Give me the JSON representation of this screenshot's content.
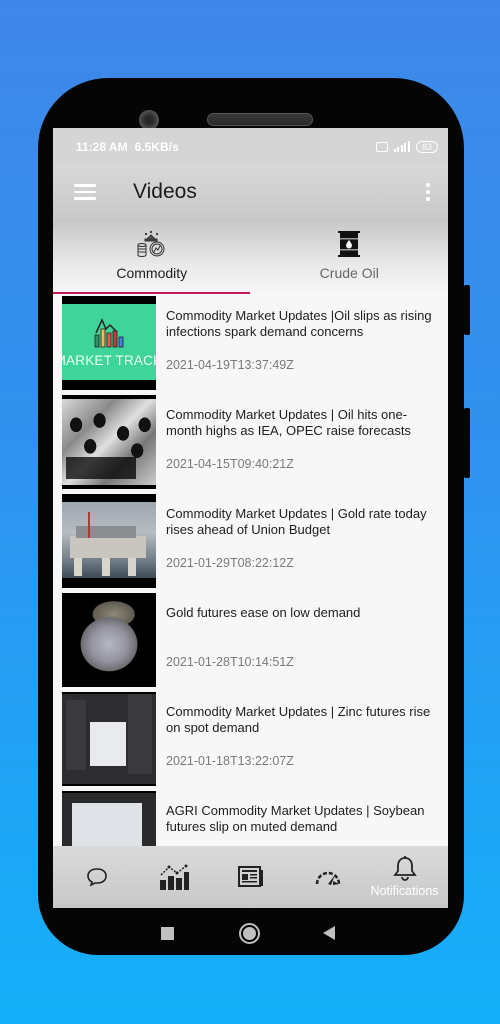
{
  "status_bar": {
    "time": "11:28 AM",
    "network_speed": "6.5KB/s",
    "network_type": "4G",
    "battery": "83"
  },
  "app_bar": {
    "title": "Videos",
    "menu_icon": "hamburger-icon",
    "overflow_icon": "kebab-icon"
  },
  "tabs": [
    {
      "label": "Commodity",
      "icon": "commodity-icon",
      "selected": true
    },
    {
      "label": "Crude Oil",
      "icon": "oil-barrel-icon",
      "selected": false
    }
  ],
  "accent_color": "#c2185b",
  "videos": [
    {
      "title": "Commodity Market Updates |Oil slips as rising infections spark demand concerns",
      "date": "2021-04-19T13:37:49Z",
      "thumb_caption": "MARKET TRACKER"
    },
    {
      "title": "Commodity Market Updates | Oil hits one-month highs as IEA, OPEC raise forecasts",
      "date": "2021-04-15T09:40:21Z"
    },
    {
      "title": "Commodity Market Updates | Gold rate today rises ahead of Union Budget",
      "date": "2021-01-29T08:22:12Z"
    },
    {
      "title": "Gold futures ease on low demand",
      "date": "2021-01-28T10:14:51Z"
    },
    {
      "title": "Commodity Market Updates | Zinc futures rise on spot demand",
      "date": "2021-01-18T13:22:07Z"
    },
    {
      "title": "AGRI Commodity Market Updates | Soybean futures slip on muted demand",
      "date": ""
    }
  ],
  "bottom_nav": [
    {
      "icon": "chat-bubble-icon",
      "label": ""
    },
    {
      "icon": "bar-chart-icon",
      "label": ""
    },
    {
      "icon": "newspaper-icon",
      "label": ""
    },
    {
      "icon": "speedometer-icon",
      "label": ""
    },
    {
      "icon": "bell-icon",
      "label": "Notifications"
    }
  ],
  "system_nav": [
    "recents-button",
    "home-button",
    "back-button"
  ]
}
